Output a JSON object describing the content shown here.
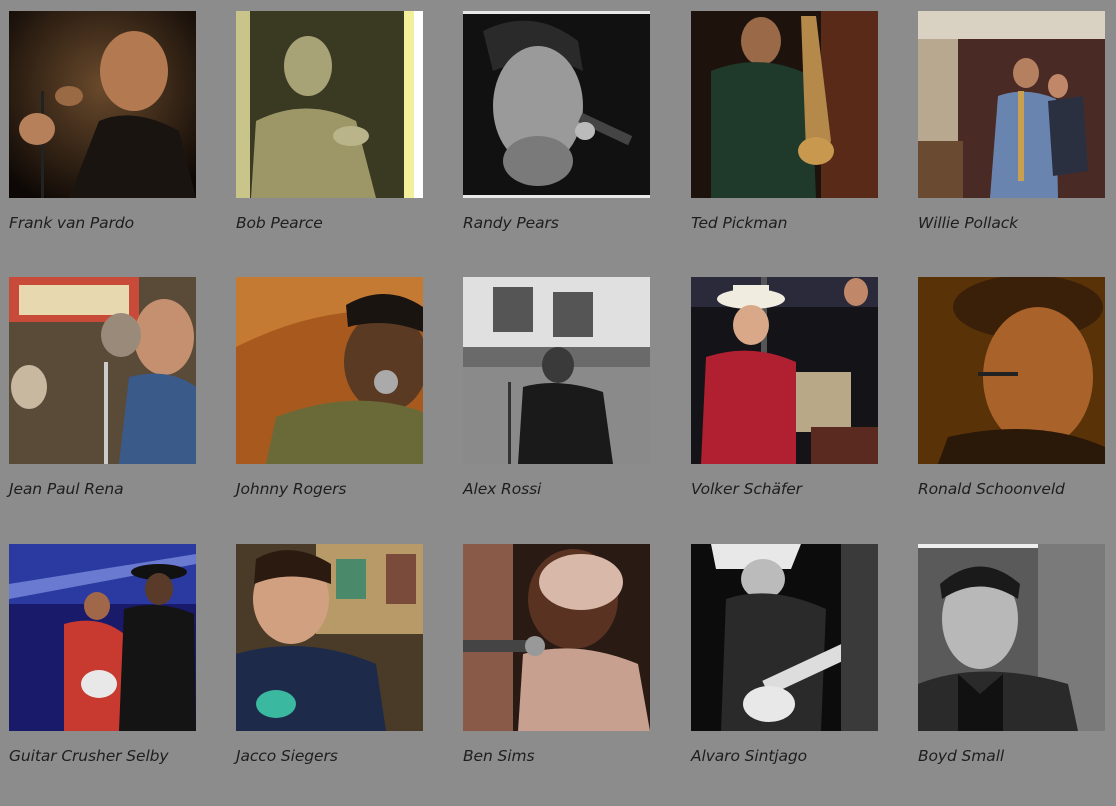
{
  "musicians": [
    {
      "name": "Frank van Pardo",
      "photo": "musician-photo"
    },
    {
      "name": "Bob Pearce",
      "photo": "musician-photo"
    },
    {
      "name": "Randy Pears",
      "photo": "musician-photo"
    },
    {
      "name": "Ted Pickman",
      "photo": "musician-photo"
    },
    {
      "name": "Willie Pollack",
      "photo": "musician-photo"
    },
    {
      "name": "Jean Paul Rena",
      "photo": "musician-photo"
    },
    {
      "name": "Johnny Rogers",
      "photo": "musician-photo"
    },
    {
      "name": "Alex Rossi",
      "photo": "musician-photo"
    },
    {
      "name": "Volker Schäfer",
      "photo": "musician-photo"
    },
    {
      "name": "Ronald Schoonveld",
      "photo": "musician-photo"
    },
    {
      "name": "Guitar Crusher Selby",
      "photo": "musician-photo"
    },
    {
      "name": "Jacco Siegers",
      "photo": "musician-photo"
    },
    {
      "name": "Ben Sims",
      "photo": "musician-photo"
    },
    {
      "name": "Alvaro Sintjago",
      "photo": "musician-photo"
    },
    {
      "name": "Boyd Small",
      "photo": "musician-photo"
    }
  ],
  "colors": {
    "background": "#8c8c8c",
    "text": "#1e1e1e"
  }
}
